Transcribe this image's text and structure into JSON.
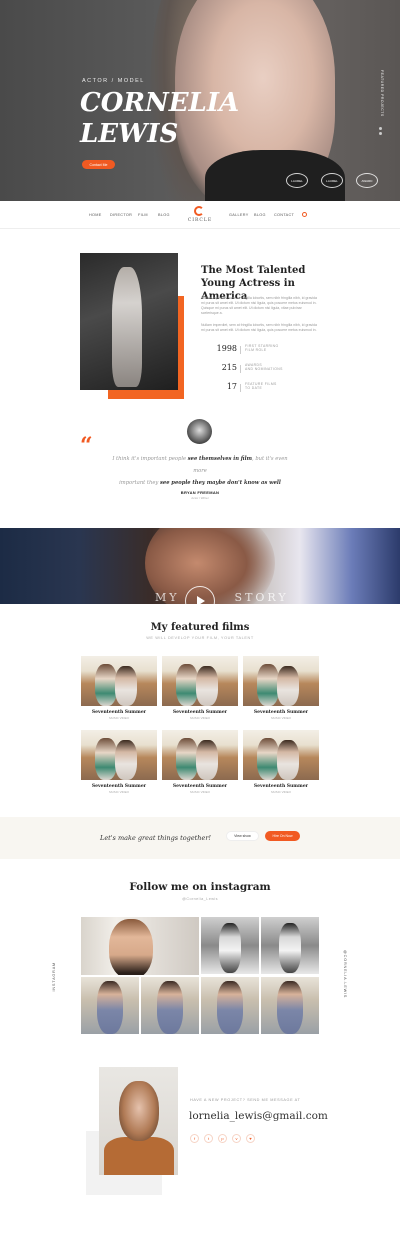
{
  "hero": {
    "eyebrow": "ACTOR  / MODEL",
    "title_line1": "CORNELIA",
    "title_line2": "LEWIS",
    "button": "Contact Me",
    "side_label": "FEATURED PROJECTS",
    "awards": [
      "LAUREL",
      "LAUREL",
      "AWARD"
    ]
  },
  "nav": {
    "left": [
      "HOME",
      "DIRECTOR",
      "FILM",
      "BLOG"
    ],
    "logo": "CIRCLE",
    "right": [
      "GALLERY",
      "BLOG",
      "CONTACT"
    ]
  },
  "about": {
    "title": "The Most Talented Young Actress in America",
    "para1": "Nullam imperdiet, sem at fringilla lobortis, sem nibh fringilla nibh, id gravida mi purus sit amet elit. Ut dictum nisi ligula, quis posuere metus euismod in. Quisque mi purus sit amet elit. Ut dictum nisi ligula, vitae pulvinar scelerisque a.",
    "para2": "Nullam imperdiet, sem at fringilla lobortis, sem nibh fringilla nibh, id gravida mi purus sit amet elit. Ut dictum nisi ligula, quis posuere metus euismod in.",
    "stats": [
      {
        "num": "1998",
        "label1": "FIRST STARRING",
        "label2": "FILM ROLE"
      },
      {
        "num": "215",
        "label1": "AWARDS",
        "label2": "AND NOMINATIONS"
      },
      {
        "num": "17",
        "label1": "FEATURE FILMS",
        "label2": "TO DATE"
      }
    ]
  },
  "quote": {
    "line1_a": "I think it's important people ",
    "line1_b": "see themselves in film",
    "line1_c": ", but it's even more",
    "line2_a": "important they ",
    "line2_b": "see people they maybe don't know as well",
    "author": "BRYAN FREEMAN",
    "role": "Actor / Writer"
  },
  "video": {
    "text_left": "MY",
    "text_right": "STORY"
  },
  "films": {
    "title": "My featured films",
    "subtitle": "WE WILL DEVELOP YOUR FILM, YOUR TALENT",
    "items": [
      {
        "name": "Seventeenth Summer",
        "cat": "MUSIC VIDEO"
      },
      {
        "name": "Seventeenth Summer",
        "cat": "MUSIC VIDEO"
      },
      {
        "name": "Seventeenth Summer",
        "cat": "MUSIC VIDEO"
      },
      {
        "name": "Seventeenth Summer",
        "cat": "MUSIC VIDEO"
      },
      {
        "name": "Seventeenth Summer",
        "cat": "MUSIC VIDEO"
      },
      {
        "name": "Seventeenth Summer",
        "cat": "MUSIC VIDEO"
      }
    ]
  },
  "cta": {
    "text": "Let's make great things together!",
    "btn1": "View show",
    "btn2": "Hire On Now"
  },
  "instagram": {
    "title": "Follow me on instagram",
    "handle": "@Cornelia_Lewis",
    "side_left": "INSTAGRAM",
    "side_right": "@CORNELIA.LEWIS"
  },
  "contact": {
    "label": "HAVE A NEW PROJECT? SEND ME MESSAGE AT",
    "email": "lornelia_lewis@gmail.com",
    "socials": [
      "f",
      "t",
      "p",
      "v",
      "♥"
    ]
  },
  "colors": {
    "accent": "#f15a22"
  }
}
